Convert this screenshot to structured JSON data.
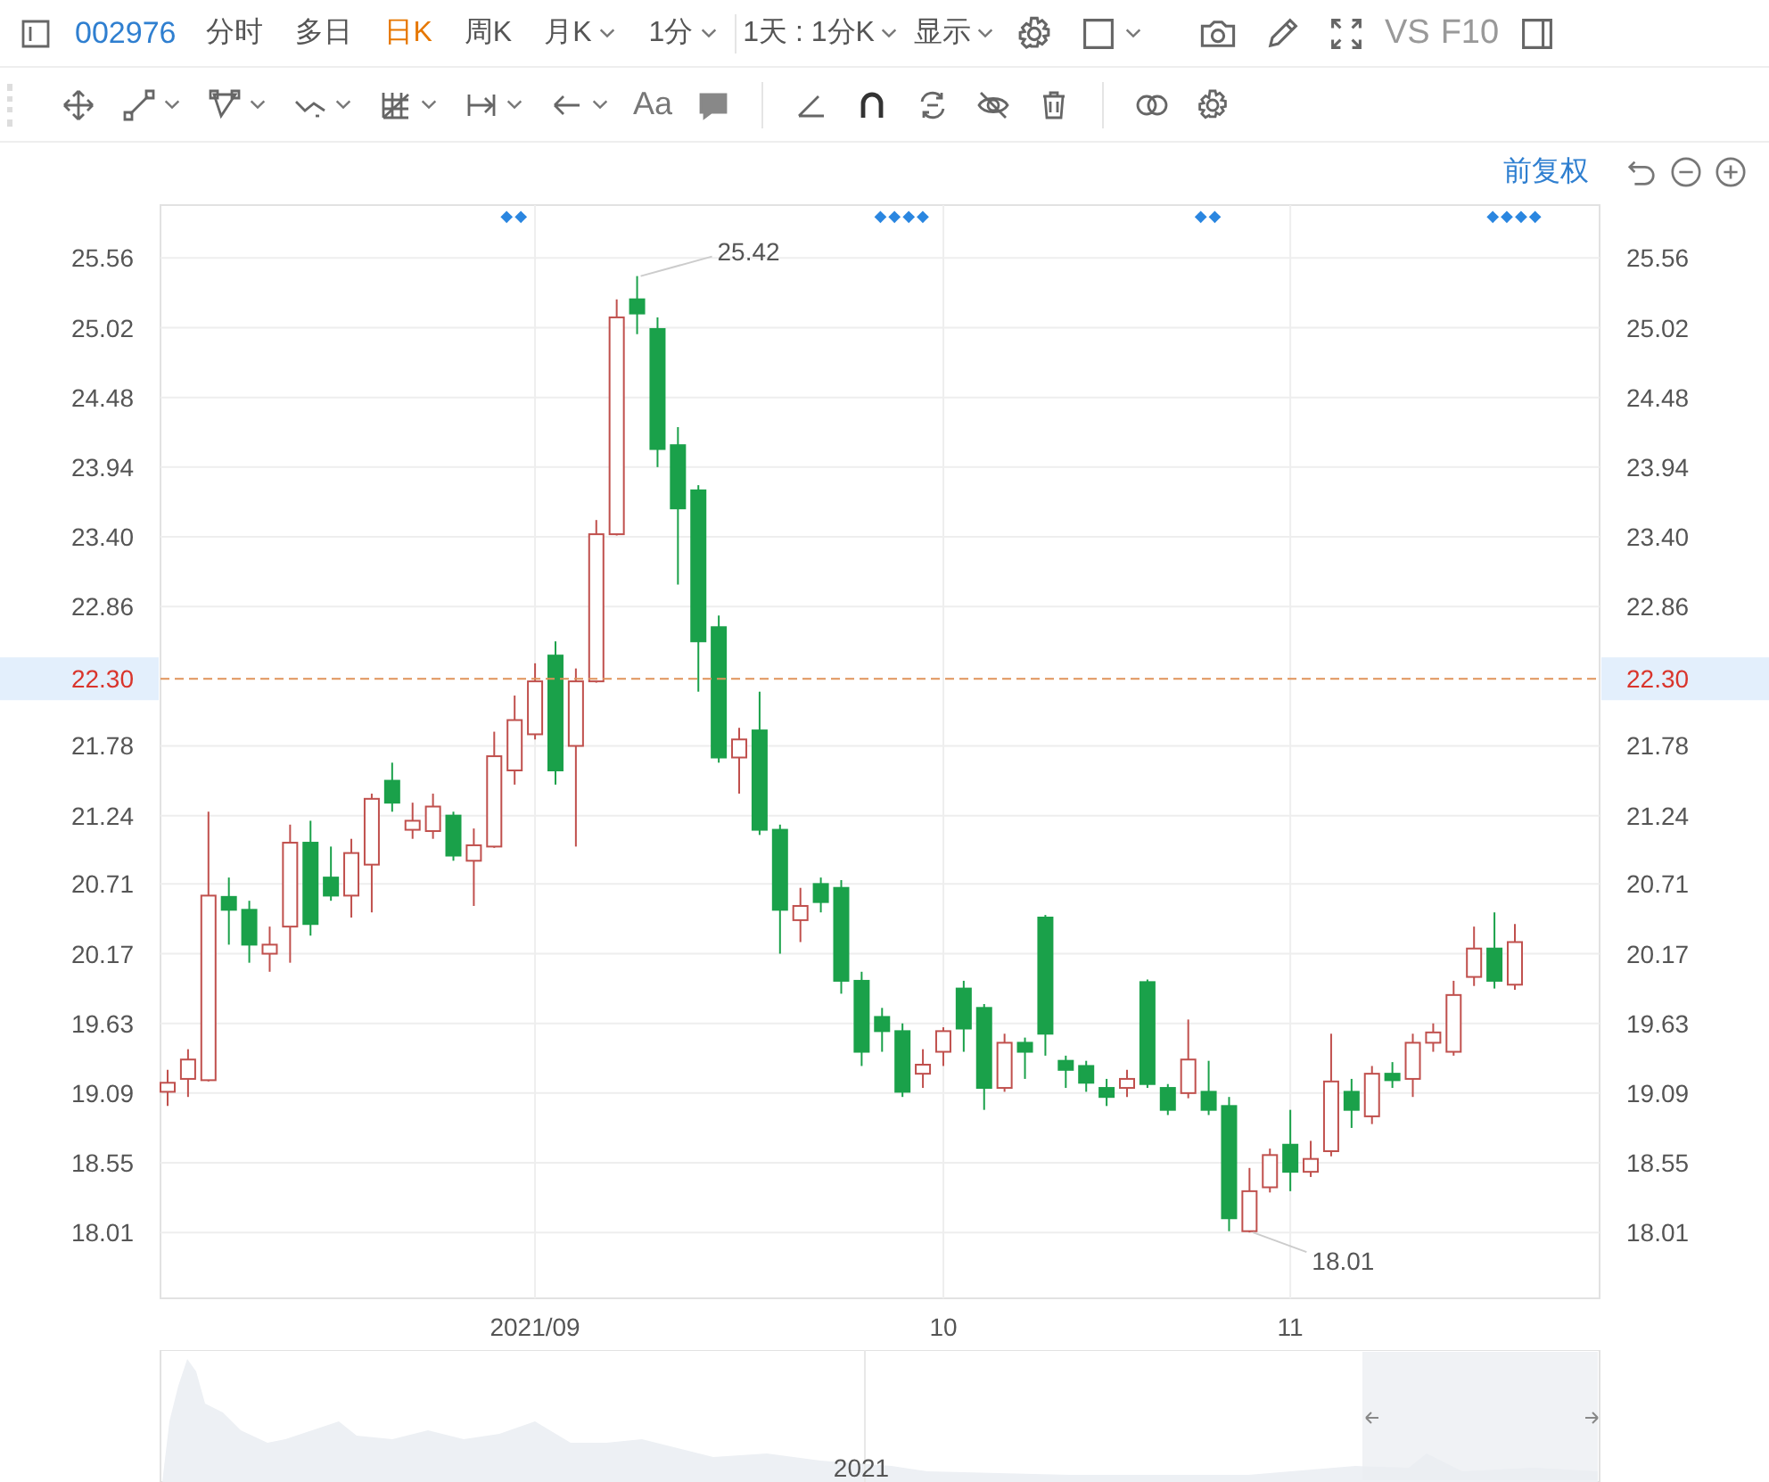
{
  "toolbar": {
    "code": "002976",
    "tabs": [
      {
        "label": "分时",
        "selected": false
      },
      {
        "label": "多日",
        "selected": false
      },
      {
        "label": "日K",
        "selected": true
      },
      {
        "label": "周K",
        "selected": false
      },
      {
        "label": "月K",
        "selected": false,
        "caret": true
      },
      {
        "label": "1分",
        "selected": false,
        "caret": true
      }
    ],
    "dropdowns": [
      {
        "label": "1天 : 1分K"
      },
      {
        "label": "显示"
      }
    ],
    "right_items": [
      {
        "kind": "gear"
      },
      {
        "kind": "square",
        "caret": true
      },
      {
        "kind": "camera"
      },
      {
        "kind": "pencil"
      },
      {
        "kind": "expand"
      },
      {
        "kind": "text",
        "label": "VS"
      },
      {
        "kind": "text",
        "label": "F10"
      },
      {
        "kind": "panel"
      }
    ]
  },
  "drawing_tools": [
    {
      "kind": "move"
    },
    {
      "kind": "segment",
      "caret": true
    },
    {
      "kind": "polygon",
      "caret": true
    },
    {
      "kind": "wave",
      "caret": true
    },
    {
      "kind": "grid",
      "caret": true
    },
    {
      "kind": "range",
      "caret": true
    },
    {
      "kind": "arrow",
      "caret": true
    },
    {
      "kind": "text",
      "label": "Aa"
    },
    {
      "kind": "note"
    },
    {
      "kind": "divider"
    },
    {
      "kind": "angle"
    },
    {
      "kind": "magnet"
    },
    {
      "kind": "sync"
    },
    {
      "kind": "eye-off"
    },
    {
      "kind": "trash"
    },
    {
      "kind": "divider"
    },
    {
      "kind": "circles"
    },
    {
      "kind": "gear"
    }
  ],
  "chart_header": {
    "adjust_link": "前复权",
    "controls": [
      {
        "kind": "undo"
      },
      {
        "kind": "zoom-out"
      },
      {
        "kind": "zoom-in"
      }
    ]
  },
  "chart": {
    "chart_data": {
      "type": "candlestick",
      "ylim": [
        17.5,
        25.97
      ],
      "grid": true,
      "ref_lines": [
        {
          "axis": "y",
          "value": 22.3
        }
      ],
      "categories": [
        null,
        null,
        null,
        null,
        null,
        null,
        null,
        null,
        null,
        null,
        null,
        null,
        null,
        null,
        null,
        null,
        null,
        null,
        "2021/09",
        null,
        null,
        null,
        null,
        null,
        null,
        null,
        null,
        null,
        null,
        null,
        null,
        null,
        null,
        null,
        null,
        null,
        null,
        null,
        "10",
        null,
        null,
        null,
        null,
        null,
        null,
        null,
        null,
        null,
        null,
        null,
        null,
        null,
        null,
        null,
        null,
        "11",
        null,
        null,
        null,
        null,
        null,
        null,
        null,
        null,
        null,
        null,
        null
      ],
      "yticks": [
        {
          "value": 25.56,
          "label": "25.56"
        },
        {
          "value": 25.02,
          "label": "25.02"
        },
        {
          "value": 24.48,
          "label": "24.48"
        },
        {
          "value": 23.94,
          "label": "23.94"
        },
        {
          "value": 23.4,
          "label": "23.40"
        },
        {
          "value": 22.86,
          "label": "22.86"
        },
        {
          "value": 21.78,
          "label": "21.78"
        },
        {
          "value": 21.24,
          "label": "21.24"
        },
        {
          "value": 20.71,
          "label": "20.71"
        },
        {
          "value": 20.17,
          "label": "20.17"
        },
        {
          "value": 19.63,
          "label": "19.63"
        },
        {
          "value": 19.09,
          "label": "19.09"
        },
        {
          "value": 18.55,
          "label": "18.55"
        },
        {
          "value": 18.01,
          "label": "18.01"
        }
      ],
      "ohlc": [
        [
          19.1,
          19.27,
          18.99,
          19.17
        ],
        [
          19.2,
          19.43,
          19.06,
          19.35
        ],
        [
          19.19,
          21.27,
          19.18,
          20.62
        ],
        [
          20.61,
          20.76,
          20.24,
          20.51
        ],
        [
          20.51,
          20.58,
          20.1,
          20.24
        ],
        [
          20.17,
          20.38,
          20.03,
          20.24
        ],
        [
          20.38,
          21.17,
          20.1,
          21.03
        ],
        [
          21.03,
          21.2,
          20.31,
          20.4
        ],
        [
          20.76,
          21.0,
          20.58,
          20.62
        ],
        [
          20.62,
          21.06,
          20.45,
          20.95
        ],
        [
          20.86,
          21.41,
          20.49,
          21.37
        ],
        [
          21.51,
          21.65,
          21.27,
          21.34
        ],
        [
          21.13,
          21.34,
          21.06,
          21.2
        ],
        [
          21.12,
          21.41,
          21.06,
          21.31
        ],
        [
          21.24,
          21.27,
          20.89,
          20.93
        ],
        [
          20.89,
          21.14,
          20.54,
          21.01
        ],
        [
          21.0,
          21.89,
          20.99,
          21.7
        ],
        [
          21.59,
          22.17,
          21.48,
          21.98
        ],
        [
          21.87,
          22.42,
          21.83,
          22.28
        ],
        [
          22.48,
          22.59,
          21.48,
          21.59
        ],
        [
          21.78,
          22.38,
          21.0,
          22.28
        ],
        [
          22.28,
          23.53,
          22.27,
          23.42
        ],
        [
          23.42,
          25.24,
          23.41,
          25.1
        ],
        [
          25.24,
          25.42,
          24.97,
          25.13
        ],
        [
          25.01,
          25.1,
          23.94,
          24.08
        ],
        [
          24.11,
          24.25,
          23.03,
          23.62
        ],
        [
          23.76,
          23.8,
          22.2,
          22.59
        ],
        [
          22.7,
          22.79,
          21.65,
          21.69
        ],
        [
          21.69,
          21.92,
          21.41,
          21.83
        ],
        [
          21.9,
          22.2,
          21.09,
          21.13
        ],
        [
          21.13,
          21.17,
          20.17,
          20.51
        ],
        [
          20.43,
          20.68,
          20.26,
          20.54
        ],
        [
          20.71,
          20.76,
          20.49,
          20.57
        ],
        [
          20.68,
          20.74,
          19.86,
          19.96
        ],
        [
          19.96,
          20.03,
          19.3,
          19.41
        ],
        [
          19.68,
          19.75,
          19.41,
          19.57
        ],
        [
          19.57,
          19.63,
          19.06,
          19.1
        ],
        [
          19.24,
          19.43,
          19.13,
          19.31
        ],
        [
          19.41,
          19.6,
          19.3,
          19.57
        ],
        [
          19.9,
          19.96,
          19.41,
          19.59
        ],
        [
          19.75,
          19.78,
          18.96,
          19.13
        ],
        [
          19.13,
          19.55,
          19.1,
          19.48
        ],
        [
          19.48,
          19.52,
          19.2,
          19.41
        ],
        [
          20.45,
          20.47,
          19.38,
          19.55
        ],
        [
          19.34,
          19.38,
          19.13,
          19.27
        ],
        [
          19.3,
          19.34,
          19.1,
          19.17
        ],
        [
          19.13,
          19.2,
          18.99,
          19.06
        ],
        [
          19.13,
          19.27,
          19.06,
          19.2
        ],
        [
          19.95,
          19.97,
          19.13,
          19.16
        ],
        [
          19.13,
          19.16,
          18.92,
          18.96
        ],
        [
          19.09,
          19.66,
          19.05,
          19.35
        ],
        [
          19.1,
          19.34,
          18.92,
          18.96
        ],
        [
          18.99,
          19.06,
          18.02,
          18.12
        ],
        [
          18.02,
          18.51,
          18.01,
          18.33
        ],
        [
          18.36,
          18.66,
          18.32,
          18.61
        ],
        [
          18.69,
          18.96,
          18.33,
          18.48
        ],
        [
          18.48,
          18.72,
          18.44,
          18.58
        ],
        [
          18.64,
          19.55,
          18.6,
          19.18
        ],
        [
          19.1,
          19.2,
          18.82,
          18.96
        ],
        [
          18.91,
          19.3,
          18.85,
          19.24
        ],
        [
          19.24,
          19.33,
          19.13,
          19.19
        ],
        [
          19.2,
          19.55,
          19.06,
          19.48
        ],
        [
          19.48,
          19.63,
          19.41,
          19.56
        ],
        [
          19.41,
          19.96,
          19.38,
          19.85
        ],
        [
          19.99,
          20.38,
          19.92,
          20.21
        ],
        [
          20.21,
          20.49,
          19.9,
          19.96
        ],
        [
          19.93,
          20.4,
          19.89,
          20.26
        ]
      ]
    },
    "right_axis": [
      "25.56",
      "25.02",
      "24.48",
      "23.94",
      "23.40",
      "22.86",
      "21.78",
      "21.24",
      "20.71",
      "20.17",
      "19.63",
      "19.09",
      "18.55",
      "18.01"
    ],
    "price_line": {
      "left_label": "22.30",
      "right_label": "22.30"
    },
    "high_label": "25.42",
    "low_label": "18.01",
    "event_markers": [
      {
        "label": "◆◆"
      },
      {
        "label": "◆◆◆◆"
      },
      {
        "label": "◆◆"
      },
      {
        "label": "◆◆◆◆"
      }
    ]
  },
  "navigator": {
    "year_label": "2021"
  }
}
